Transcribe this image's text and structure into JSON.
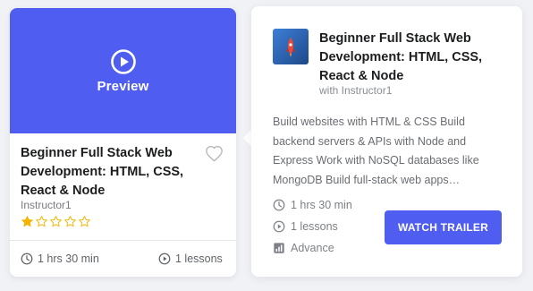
{
  "colors": {
    "accent": "#4f5ef0",
    "page_background": "#f1f2f6",
    "card_background": "#ffffff",
    "star": "#f4b400"
  },
  "course_card": {
    "preview_label": "Preview",
    "preview_icon": "play-circle-icon",
    "title": "Beginner Full Stack Web Development: HTML, CSS, React & Node",
    "wishlist_icon": "heart-outline-icon",
    "instructor": "Instructor1",
    "rating": 1,
    "rating_max": 5,
    "duration_icon": "clock-icon",
    "duration": "1 hrs 30 min",
    "lessons_icon": "play-circle-icon",
    "lessons": "1 lessons"
  },
  "popover": {
    "thumbnail_icon": "course-thumbnail-icon",
    "title": "Beginner Full Stack Web Development: HTML, CSS, React & Node",
    "instructor_line": "with Instructor1",
    "description": "Build websites with HTML & CSS Build backend servers & APIs with Node and Express Work with NoSQL databases like MongoDB Build full-stack web apps…",
    "meta": {
      "duration": "1 hrs 30 min",
      "lessons": "1 lessons",
      "level": "Advance"
    },
    "meta_icons": {
      "duration": "clock-icon",
      "lessons": "play-circle-icon",
      "level": "bar-chart-icon"
    },
    "watch_trailer_label": "WATCH TRAILER"
  }
}
